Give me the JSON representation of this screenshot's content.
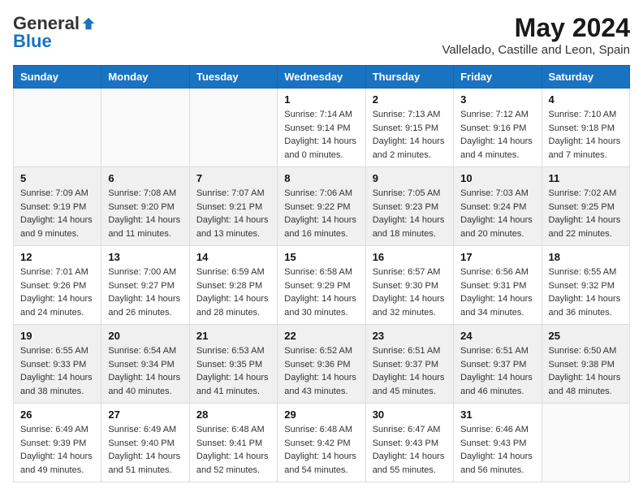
{
  "header": {
    "logo_general": "General",
    "logo_blue": "Blue",
    "month_year": "May 2024",
    "location": "Vallelado, Castille and Leon, Spain"
  },
  "days_of_week": [
    "Sunday",
    "Monday",
    "Tuesday",
    "Wednesday",
    "Thursday",
    "Friday",
    "Saturday"
  ],
  "weeks": [
    {
      "shaded": false,
      "days": [
        {
          "number": "",
          "sunrise": "",
          "sunset": "",
          "daylight": ""
        },
        {
          "number": "",
          "sunrise": "",
          "sunset": "",
          "daylight": ""
        },
        {
          "number": "",
          "sunrise": "",
          "sunset": "",
          "daylight": ""
        },
        {
          "number": "1",
          "sunrise": "Sunrise: 7:14 AM",
          "sunset": "Sunset: 9:14 PM",
          "daylight": "Daylight: 14 hours and 0 minutes."
        },
        {
          "number": "2",
          "sunrise": "Sunrise: 7:13 AM",
          "sunset": "Sunset: 9:15 PM",
          "daylight": "Daylight: 14 hours and 2 minutes."
        },
        {
          "number": "3",
          "sunrise": "Sunrise: 7:12 AM",
          "sunset": "Sunset: 9:16 PM",
          "daylight": "Daylight: 14 hours and 4 minutes."
        },
        {
          "number": "4",
          "sunrise": "Sunrise: 7:10 AM",
          "sunset": "Sunset: 9:18 PM",
          "daylight": "Daylight: 14 hours and 7 minutes."
        }
      ]
    },
    {
      "shaded": true,
      "days": [
        {
          "number": "5",
          "sunrise": "Sunrise: 7:09 AM",
          "sunset": "Sunset: 9:19 PM",
          "daylight": "Daylight: 14 hours and 9 minutes."
        },
        {
          "number": "6",
          "sunrise": "Sunrise: 7:08 AM",
          "sunset": "Sunset: 9:20 PM",
          "daylight": "Daylight: 14 hours and 11 minutes."
        },
        {
          "number": "7",
          "sunrise": "Sunrise: 7:07 AM",
          "sunset": "Sunset: 9:21 PM",
          "daylight": "Daylight: 14 hours and 13 minutes."
        },
        {
          "number": "8",
          "sunrise": "Sunrise: 7:06 AM",
          "sunset": "Sunset: 9:22 PM",
          "daylight": "Daylight: 14 hours and 16 minutes."
        },
        {
          "number": "9",
          "sunrise": "Sunrise: 7:05 AM",
          "sunset": "Sunset: 9:23 PM",
          "daylight": "Daylight: 14 hours and 18 minutes."
        },
        {
          "number": "10",
          "sunrise": "Sunrise: 7:03 AM",
          "sunset": "Sunset: 9:24 PM",
          "daylight": "Daylight: 14 hours and 20 minutes."
        },
        {
          "number": "11",
          "sunrise": "Sunrise: 7:02 AM",
          "sunset": "Sunset: 9:25 PM",
          "daylight": "Daylight: 14 hours and 22 minutes."
        }
      ]
    },
    {
      "shaded": false,
      "days": [
        {
          "number": "12",
          "sunrise": "Sunrise: 7:01 AM",
          "sunset": "Sunset: 9:26 PM",
          "daylight": "Daylight: 14 hours and 24 minutes."
        },
        {
          "number": "13",
          "sunrise": "Sunrise: 7:00 AM",
          "sunset": "Sunset: 9:27 PM",
          "daylight": "Daylight: 14 hours and 26 minutes."
        },
        {
          "number": "14",
          "sunrise": "Sunrise: 6:59 AM",
          "sunset": "Sunset: 9:28 PM",
          "daylight": "Daylight: 14 hours and 28 minutes."
        },
        {
          "number": "15",
          "sunrise": "Sunrise: 6:58 AM",
          "sunset": "Sunset: 9:29 PM",
          "daylight": "Daylight: 14 hours and 30 minutes."
        },
        {
          "number": "16",
          "sunrise": "Sunrise: 6:57 AM",
          "sunset": "Sunset: 9:30 PM",
          "daylight": "Daylight: 14 hours and 32 minutes."
        },
        {
          "number": "17",
          "sunrise": "Sunrise: 6:56 AM",
          "sunset": "Sunset: 9:31 PM",
          "daylight": "Daylight: 14 hours and 34 minutes."
        },
        {
          "number": "18",
          "sunrise": "Sunrise: 6:55 AM",
          "sunset": "Sunset: 9:32 PM",
          "daylight": "Daylight: 14 hours and 36 minutes."
        }
      ]
    },
    {
      "shaded": true,
      "days": [
        {
          "number": "19",
          "sunrise": "Sunrise: 6:55 AM",
          "sunset": "Sunset: 9:33 PM",
          "daylight": "Daylight: 14 hours and 38 minutes."
        },
        {
          "number": "20",
          "sunrise": "Sunrise: 6:54 AM",
          "sunset": "Sunset: 9:34 PM",
          "daylight": "Daylight: 14 hours and 40 minutes."
        },
        {
          "number": "21",
          "sunrise": "Sunrise: 6:53 AM",
          "sunset": "Sunset: 9:35 PM",
          "daylight": "Daylight: 14 hours and 41 minutes."
        },
        {
          "number": "22",
          "sunrise": "Sunrise: 6:52 AM",
          "sunset": "Sunset: 9:36 PM",
          "daylight": "Daylight: 14 hours and 43 minutes."
        },
        {
          "number": "23",
          "sunrise": "Sunrise: 6:51 AM",
          "sunset": "Sunset: 9:37 PM",
          "daylight": "Daylight: 14 hours and 45 minutes."
        },
        {
          "number": "24",
          "sunrise": "Sunrise: 6:51 AM",
          "sunset": "Sunset: 9:37 PM",
          "daylight": "Daylight: 14 hours and 46 minutes."
        },
        {
          "number": "25",
          "sunrise": "Sunrise: 6:50 AM",
          "sunset": "Sunset: 9:38 PM",
          "daylight": "Daylight: 14 hours and 48 minutes."
        }
      ]
    },
    {
      "shaded": false,
      "days": [
        {
          "number": "26",
          "sunrise": "Sunrise: 6:49 AM",
          "sunset": "Sunset: 9:39 PM",
          "daylight": "Daylight: 14 hours and 49 minutes."
        },
        {
          "number": "27",
          "sunrise": "Sunrise: 6:49 AM",
          "sunset": "Sunset: 9:40 PM",
          "daylight": "Daylight: 14 hours and 51 minutes."
        },
        {
          "number": "28",
          "sunrise": "Sunrise: 6:48 AM",
          "sunset": "Sunset: 9:41 PM",
          "daylight": "Daylight: 14 hours and 52 minutes."
        },
        {
          "number": "29",
          "sunrise": "Sunrise: 6:48 AM",
          "sunset": "Sunset: 9:42 PM",
          "daylight": "Daylight: 14 hours and 54 minutes."
        },
        {
          "number": "30",
          "sunrise": "Sunrise: 6:47 AM",
          "sunset": "Sunset: 9:43 PM",
          "daylight": "Daylight: 14 hours and 55 minutes."
        },
        {
          "number": "31",
          "sunrise": "Sunrise: 6:46 AM",
          "sunset": "Sunset: 9:43 PM",
          "daylight": "Daylight: 14 hours and 56 minutes."
        },
        {
          "number": "",
          "sunrise": "",
          "sunset": "",
          "daylight": ""
        }
      ]
    }
  ]
}
